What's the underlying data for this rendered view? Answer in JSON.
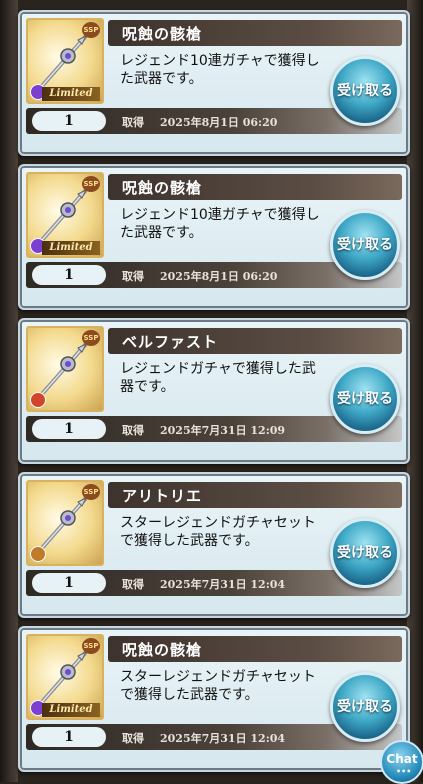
{
  "items": [
    {
      "name": "呪蝕の骸槍",
      "description": "レジェンド10連ガチャで獲得した武器です。",
      "quantity": "1",
      "obtained_label": "取得",
      "date": "2025年8月1日 06:20",
      "button": "受け取る",
      "rarity": "SSP",
      "badge": "Limited",
      "attr_color": "#7b3fd1",
      "weapon_icon": "spear-weapon-icon"
    },
    {
      "name": "呪蝕の骸槍",
      "description": "レジェンド10連ガチャで獲得した武器です。",
      "quantity": "1",
      "obtained_label": "取得",
      "date": "2025年8月1日 06:20",
      "button": "受け取る",
      "rarity": "SSP",
      "badge": "Limited",
      "attr_color": "#7b3fd1",
      "weapon_icon": "spear-weapon-icon"
    },
    {
      "name": "ベルファスト",
      "description": "レジェンドガチャで獲得した武器です。",
      "quantity": "1",
      "obtained_label": "取得",
      "date": "2025年7月31日 12:09",
      "button": "受け取る",
      "rarity": "SSP",
      "badge": "",
      "attr_color": "#d2452a",
      "weapon_icon": "lance-weapon-icon"
    },
    {
      "name": "アリトリエ",
      "description": "スターレジェンドガチャセットで獲得した武器です。",
      "quantity": "1",
      "obtained_label": "取得",
      "date": "2025年7月31日 12:04",
      "button": "受け取る",
      "rarity": "SSP",
      "badge": "",
      "attr_color": "#c07a2a",
      "weapon_icon": "spear-weapon-icon"
    },
    {
      "name": "呪蝕の骸槍",
      "description": "スターレジェンドガチャセットで獲得した武器です。",
      "quantity": "1",
      "obtained_label": "取得",
      "date": "2025年7月31日 12:04",
      "button": "受け取る",
      "rarity": "SSP",
      "badge": "Limited",
      "attr_color": "#7b3fd1",
      "weapon_icon": "spear-weapon-icon"
    }
  ],
  "chat_button": {
    "label": "Chat",
    "dots": "•••"
  }
}
